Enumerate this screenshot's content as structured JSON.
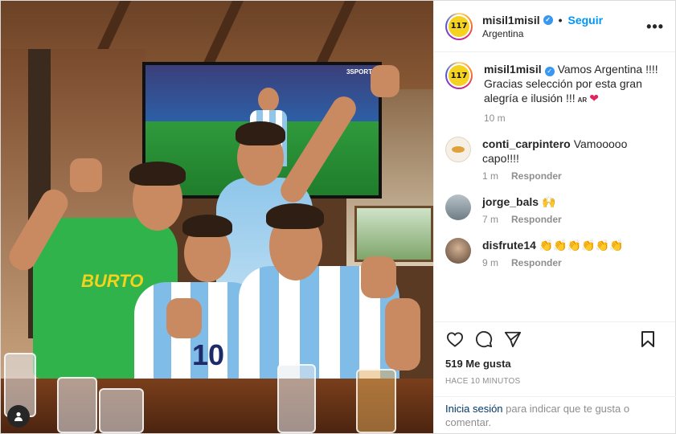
{
  "header": {
    "username": "misil1misil",
    "follow_label": "Seguir",
    "location": "Argentina",
    "avatar_text": "117",
    "more_label": "•••",
    "separator": "•"
  },
  "caption": {
    "username": "misil1misil",
    "text": "Vamos Argentina !!!! Gracias selección por esta gran alegría e ilusión !!!",
    "flag_text": "AR",
    "heart": "❤",
    "time": "10 m"
  },
  "comments": [
    {
      "username": "conti_carpintero",
      "text": "Vamooooo capo!!!!",
      "time": "1 m",
      "reply_label": "Responder"
    },
    {
      "username": "jorge_bals",
      "text": "🙌",
      "time": "7 m",
      "reply_label": "Responder"
    },
    {
      "username": "disfrute14",
      "text": "👏👏👏👏👏👏",
      "time": "9 m",
      "reply_label": "Responder"
    }
  ],
  "actions": {
    "like_icon": "heart-icon",
    "comment_icon": "comment-icon",
    "share_icon": "share-icon",
    "save_icon": "bookmark-icon"
  },
  "likes_text": "519 Me gusta",
  "posted_ago": "HACE 10 MINUTOS",
  "login": {
    "link_label": "Inicia sesión",
    "rest_text": " para indicar que te gusta o comentar."
  },
  "photo": {
    "tv_logo": "3SPORT",
    "shirt_text": "BURTO",
    "jersey_number": "10"
  },
  "colors": {
    "accent_blue": "#0095f6",
    "verified_blue": "#3897f0",
    "heart_red": "#e0245e",
    "link_dark": "#00376b"
  }
}
